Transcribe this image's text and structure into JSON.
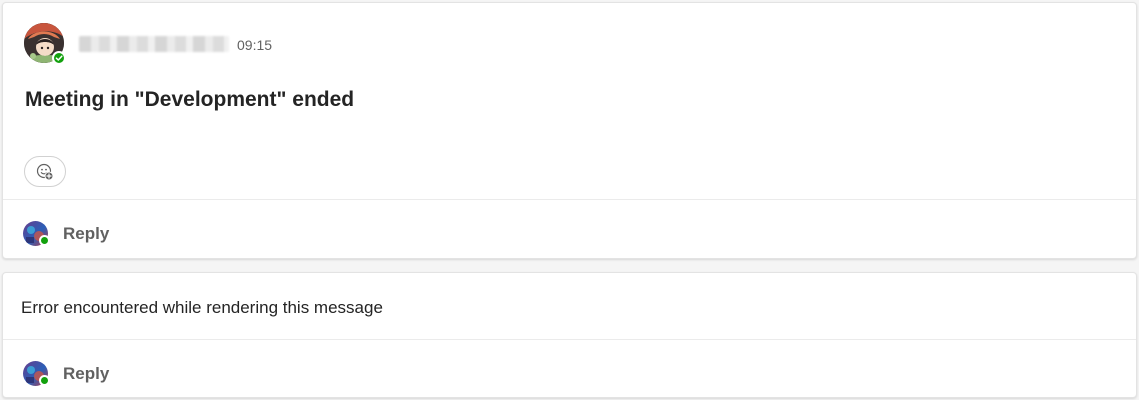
{
  "messages": [
    {
      "time": "09:15",
      "title": "Meeting in \"Development\" ended",
      "reply_label": "Reply"
    },
    {
      "error_text": "Error encountered while rendering this message",
      "reply_label": "Reply"
    }
  ],
  "icons": {
    "presence": "presence-available-icon",
    "reaction": "emoji-add-icon"
  },
  "colors": {
    "presence_available": "#13a10e",
    "card_background": "#ffffff",
    "page_background": "#f5f5f5"
  }
}
